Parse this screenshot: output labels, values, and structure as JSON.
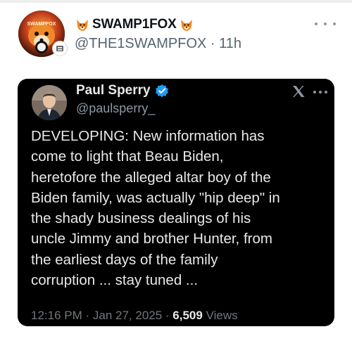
{
  "post": {
    "display_name": "SWAMP1FOX",
    "handle": "@THE1SWAMPFOX",
    "separator": " · ",
    "time_ago": "11h",
    "avatar_text": "SWAMPFOX",
    "icons": {
      "name_prefix": "fox-icon",
      "name_suffix": "fox-icon",
      "badge": "verified-org-badge",
      "more": "more-options-icon"
    }
  },
  "embedded_tweet": {
    "display_name": "Paul Sperry",
    "handle": "@paulsperry_",
    "text": "DEVELOPING: New information has\ncome to light that Beau Biden,\nheretofore the alleged altar boy of the\nBiden family, was actually \"hip deep\" in\nthe shady business dealings of his\nuncle Jimmy and brother Hunter, from\nthe earliest days of the family\ncorruption ... stay tuned ...",
    "time": "12:16 PM",
    "date": "Jan 27, 2025",
    "separator": " · ",
    "views_count": "6,509",
    "views_label": " Views",
    "icons": {
      "verified": "verified-check-icon",
      "logo": "x-logo-icon",
      "more": "more-options-icon"
    }
  },
  "colors": {
    "background": "#ffffff",
    "text_primary": "#0f1419",
    "text_secondary": "#536471",
    "embed_background": "#000000",
    "embed_text": "#e7e9ea",
    "embed_muted": "#71767b",
    "verified_blue": "#1d9bf0",
    "fox_orange": "#f08a24"
  }
}
